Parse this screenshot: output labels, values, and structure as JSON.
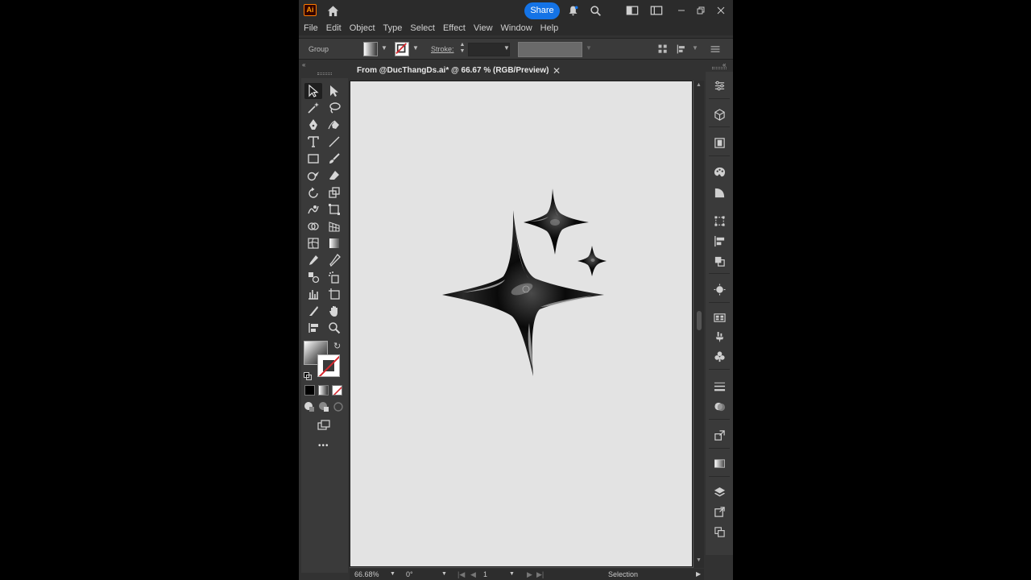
{
  "app": {
    "logo_text": "Ai",
    "share_label": "Share"
  },
  "menu": {
    "items": [
      "File",
      "Edit",
      "Object",
      "Type",
      "Select",
      "Effect",
      "View",
      "Window",
      "Help"
    ]
  },
  "controlbar": {
    "selection_label": "Group",
    "stroke_label": "Stroke:"
  },
  "document": {
    "tab_title": "From @DucThangDs.ai* @ 66.67 % (RGB/Preview)",
    "close_glyph": "✕"
  },
  "statusbar": {
    "zoom": "66.68%",
    "rotation": "0°",
    "artboard_number": "1",
    "tool_name": "Selection"
  },
  "colors": {
    "app_bg": "#323232",
    "panel_bg": "#3a3a3a",
    "artboard_bg": "#e3e3e3",
    "accent": "#1473e6",
    "ai_brand": "#ff9a00"
  },
  "toolbar": {
    "tools": [
      "selection-tool-icon",
      "direct-selection-tool-icon",
      "magic-wand-tool-icon",
      "lasso-tool-icon",
      "pen-tool-icon",
      "curvature-tool-icon",
      "type-tool-icon",
      "line-segment-tool-icon",
      "rectangle-tool-icon",
      "paintbrush-tool-icon",
      "shaper-tool-icon",
      "eraser-tool-icon",
      "rotate-tool-icon",
      "scale-tool-icon",
      "warp-tool-icon",
      "free-transform-tool-icon",
      "shape-builder-tool-icon",
      "perspective-grid-tool-icon",
      "mesh-tool-icon",
      "gradient-tool-icon",
      "eyedropper-tool-icon",
      "measure-tool-icon",
      "blend-tool-icon",
      "symbol-sprayer-tool-icon",
      "column-graph-tool-icon",
      "artboard-tool-icon",
      "slice-tool-icon",
      "hand-tool-icon",
      "print-tiling-tool-icon",
      "zoom-tool-icon"
    ],
    "more_glyph": "•••"
  }
}
